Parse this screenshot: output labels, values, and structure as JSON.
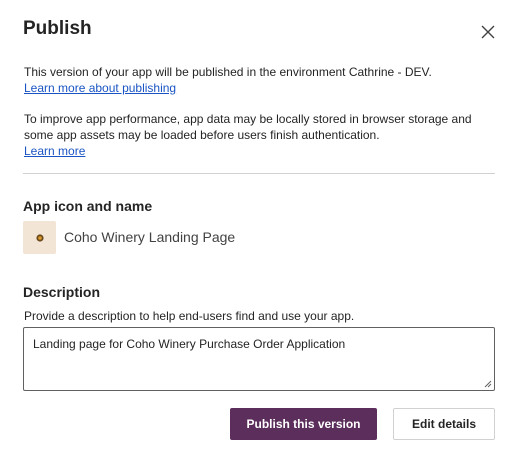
{
  "dialog": {
    "title": "Publish",
    "close_icon": "close-icon"
  },
  "info": {
    "line1": "This version of your app will be published in the environment Cathrine - DEV.",
    "learn_more_publishing": "Learn more about publishing",
    "line2a": "To improve app performance, app data may be locally stored in browser storage and",
    "line2b": "some app assets may be loaded before users finish authentication.",
    "learn_more": "Learn more"
  },
  "app": {
    "section_heading": "App icon and name",
    "icon": "app-logo-icon",
    "icon_background": "#f2e5d6",
    "name": "Coho Winery Landing Page"
  },
  "description": {
    "heading": "Description",
    "helper": "Provide a description to help end-users find and use your app.",
    "value": "Landing page for Coho Winery Purchase Order Application"
  },
  "actions": {
    "publish_label": "Publish this version",
    "edit_label": "Edit details",
    "primary_color": "#5c2e5b"
  }
}
